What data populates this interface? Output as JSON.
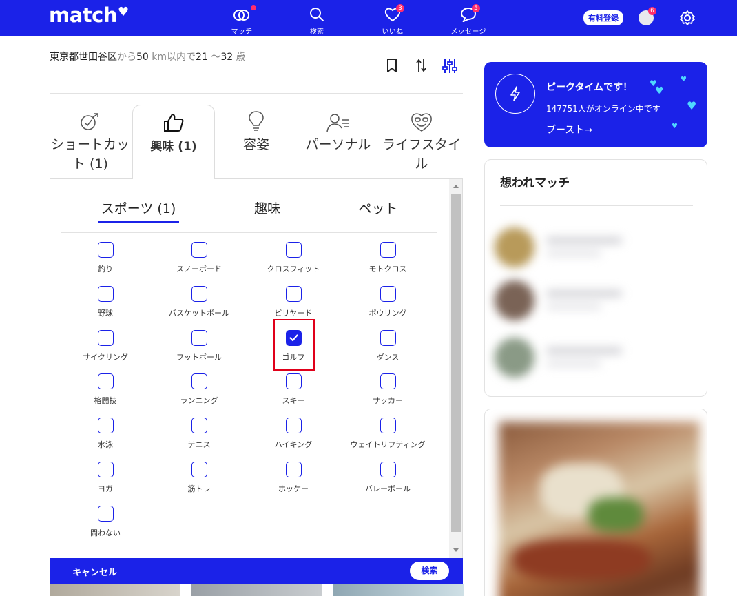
{
  "header": {
    "logo": "match",
    "nav": [
      {
        "label": "マッチ",
        "icon": "rings-icon",
        "badge": ""
      },
      {
        "label": "検索",
        "icon": "search-icon",
        "badge": ""
      },
      {
        "label": "いいね",
        "icon": "heart-icon",
        "badge": "3"
      },
      {
        "label": "メッセージ",
        "icon": "chat-bubble-icon",
        "badge": "5"
      }
    ],
    "paid_label": "有料登録",
    "avatar_badge": "6",
    "brand_color": "#1b22e8",
    "badge_color": "#ff2d6d"
  },
  "condition": {
    "location": "東京都世田谷区",
    "from": "から",
    "distance": "50",
    "km_within": "km以内で",
    "age_min": "21",
    "tilde": "〜",
    "age_max": "32",
    "age_unit": "歳"
  },
  "categories": [
    {
      "label": "ショートカット (1)",
      "icon": "shortcut-icon"
    },
    {
      "label": "興味 (1)",
      "icon": "thumbs-up-icon"
    },
    {
      "label": "容姿",
      "icon": "lightbulb-icon"
    },
    {
      "label": "パーソナル",
      "icon": "person-list-icon"
    },
    {
      "label": "ライフスタイル",
      "icon": "smiley-heart-icon"
    }
  ],
  "subtabs": [
    "スポーツ (1)",
    "趣味",
    "ペット"
  ],
  "options": [
    {
      "label": "釣り",
      "checked": false
    },
    {
      "label": "スノーボード",
      "checked": false
    },
    {
      "label": "クロスフィット",
      "checked": false
    },
    {
      "label": "モトクロス",
      "checked": false
    },
    {
      "label": "野球",
      "checked": false
    },
    {
      "label": "バスケットボール",
      "checked": false
    },
    {
      "label": "ビリヤード",
      "checked": false
    },
    {
      "label": "ボウリング",
      "checked": false
    },
    {
      "label": "サイクリング",
      "checked": false
    },
    {
      "label": "フットボール",
      "checked": false
    },
    {
      "label": "ゴルフ",
      "checked": true
    },
    {
      "label": "ダンス",
      "checked": false
    },
    {
      "label": "格闘技",
      "checked": false
    },
    {
      "label": "ランニング",
      "checked": false
    },
    {
      "label": "スキー",
      "checked": false
    },
    {
      "label": "サッカー",
      "checked": false
    },
    {
      "label": "水泳",
      "checked": false
    },
    {
      "label": "テニス",
      "checked": false
    },
    {
      "label": "ハイキング",
      "checked": false
    },
    {
      "label": "ウェイトリフティング",
      "checked": false
    },
    {
      "label": "ヨガ",
      "checked": false
    },
    {
      "label": "筋トレ",
      "checked": false
    },
    {
      "label": "ホッケー",
      "checked": false
    },
    {
      "label": "バレーボール",
      "checked": false
    },
    {
      "label": "問わない",
      "checked": false
    }
  ],
  "bottom_bar": {
    "cancel": "キャンセル",
    "search": "検索"
  },
  "peak": {
    "title": "ピークタイムです！",
    "online": "147751人がオンライン中です",
    "boost": "ブースト→"
  },
  "omoware": {
    "title": "想われマッチ"
  }
}
